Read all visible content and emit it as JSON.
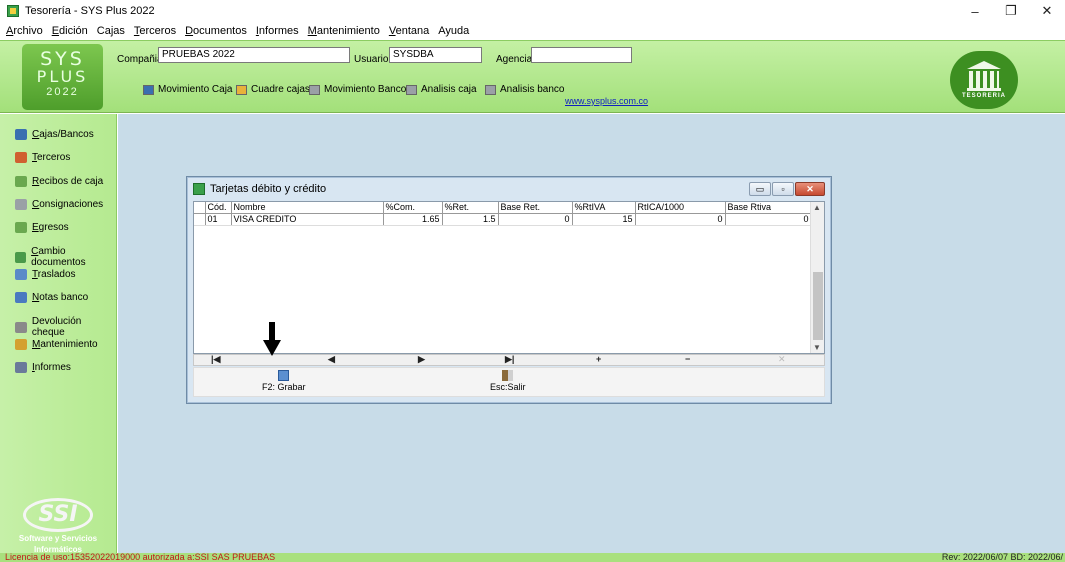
{
  "window": {
    "title": "Tesorería - SYS Plus 2022",
    "controls": [
      "–",
      "❐",
      "✕"
    ]
  },
  "menu": [
    "Archivo",
    "Edición",
    "Cajas",
    "Terceros",
    "Documentos",
    "Informes",
    "Mantenimiento",
    "Ventana",
    "Ayuda"
  ],
  "header": {
    "logo": {
      "line1": "SYS",
      "line2": "PLUS",
      "line3": "2022"
    },
    "company_label": "Compañia:",
    "company_value": "PRUEBAS 2022",
    "user_label": "Usuario:",
    "user_value": "SYSDBA",
    "agency_label": "Agencia:",
    "agency_value": "",
    "toolbar": [
      {
        "label": "Movimiento Caja",
        "icon": "cash-register-icon",
        "color": "#3a6fb0"
      },
      {
        "label": "Cuadre cajas",
        "icon": "clipboard-icon",
        "color": "#e8b23a"
      },
      {
        "label": "Movimiento Banco",
        "icon": "bank-icon",
        "color": "#9aa0a6"
      },
      {
        "label": "Analisis caja",
        "icon": "bank-icon",
        "color": "#9aa0a6"
      },
      {
        "label": "Analisis banco",
        "icon": "bank-icon",
        "color": "#9aa0a6"
      }
    ],
    "website": "www.sysplus.com.co",
    "right_logo_text": "TESORERIA"
  },
  "sidebar": {
    "items": [
      {
        "label": "Cajas/Bancos",
        "icon": "cash-register-icon",
        "color": "#3a6fb0"
      },
      {
        "label": "Terceros",
        "icon": "person-icon",
        "color": "#d06030"
      },
      {
        "label": "Recibos de caja",
        "icon": "people-icon",
        "color": "#6aa84f"
      },
      {
        "label": "Consignaciones",
        "icon": "bank-icon",
        "color": "#9aa0a6"
      },
      {
        "label": "Egresos",
        "icon": "people-icon",
        "color": "#6aa84f"
      },
      {
        "label": "Cambio documentos",
        "icon": "document-swap-icon",
        "color": "#4a9a4a"
      },
      {
        "label": "Traslados",
        "icon": "transfer-icon",
        "color": "#5a8ac8"
      },
      {
        "label": "Notas banco",
        "icon": "note-icon",
        "color": "#4a7ac0"
      },
      {
        "label": "Devolución cheque",
        "icon": "return-arrow-icon",
        "color": "#8a8a8a"
      },
      {
        "label": "Mantenimiento",
        "icon": "gear-icon",
        "color": "#d4a030"
      },
      {
        "label": "Informes",
        "icon": "printer-icon",
        "color": "#6a7a9a"
      }
    ],
    "footer_logo": {
      "mark": "SSI",
      "caption1": "Software y Servicios",
      "caption2": "Informáticos"
    }
  },
  "dialog": {
    "title": "Tarjetas débito y crédito",
    "controls": [
      "▭",
      "▫",
      "✕"
    ],
    "columns": [
      "Cód.",
      "Nombre",
      "%Com.",
      "%Ret.",
      "Base Ret.",
      "%RtIVA",
      "RtICA/1000",
      "Base Rtiva"
    ],
    "rows": [
      [
        "01",
        "VISA CREDITO",
        "1.65",
        "1.5",
        "0",
        "15",
        "0",
        "0"
      ]
    ],
    "navigator": [
      "|◀",
      "◀",
      "▶",
      "▶|",
      "+",
      "−",
      "✕"
    ],
    "buttons": [
      {
        "label": "F2: Grabar",
        "icon": "save-disk-icon"
      },
      {
        "label": "Esc:Salir",
        "icon": "exit-door-icon"
      }
    ]
  },
  "status": {
    "left": "Licencia de uso:15352022019000 autorizada a:SSI SAS PRUEBAS",
    "right": "Rev: 2022/06/07 BD: 2022/06/"
  },
  "colors": {
    "panel_green": "#a3e07a",
    "main_bg": "#c8dce8",
    "license_red": "#c01818"
  }
}
